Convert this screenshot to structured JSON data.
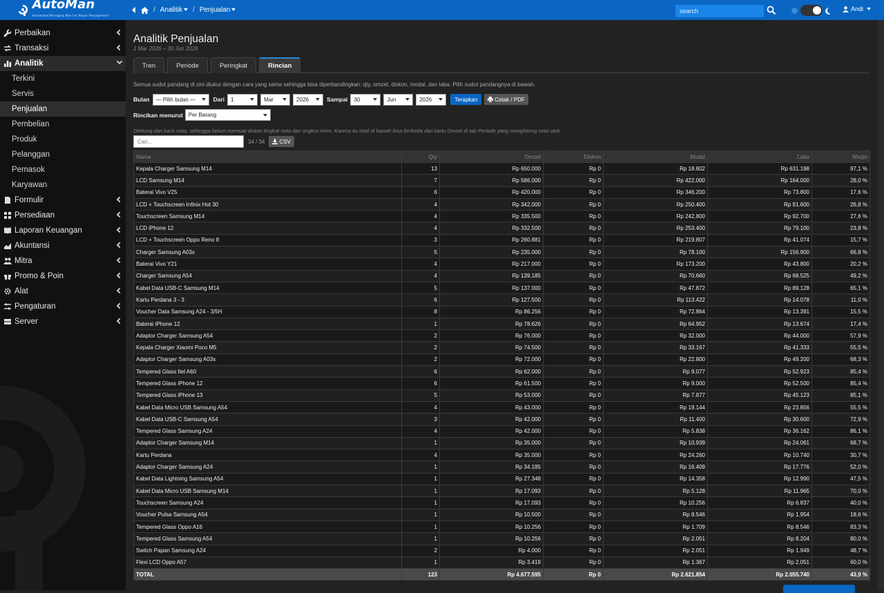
{
  "app": {
    "brand": "AutoMan",
    "brand_sub": "Automated Managing Man For Repair Management"
  },
  "breadcrumb": {
    "level1": "Analitik",
    "level2": "Penjualan"
  },
  "topbar": {
    "search_placeholder": "search",
    "user": "Andi"
  },
  "sidebar": {
    "items": [
      {
        "label": "Perbaikan",
        "icon": "wrench-icon"
      },
      {
        "label": "Transaksi",
        "icon": "exchange-icon"
      },
      {
        "label": "Analitik",
        "icon": "chart-icon"
      },
      {
        "label": "Formulir",
        "icon": "file-icon"
      },
      {
        "label": "Persediaan",
        "icon": "grid-icon"
      },
      {
        "label": "Laporan Keuangan",
        "icon": "book-icon"
      },
      {
        "label": "Akuntansi",
        "icon": "area-chart-icon"
      },
      {
        "label": "Mitra",
        "icon": "users-icon"
      },
      {
        "label": "Promo & Poin",
        "icon": "gift-icon"
      },
      {
        "label": "Alat",
        "icon": "cogs-icon"
      },
      {
        "label": "Pengaturan",
        "icon": "sliders-icon"
      },
      {
        "label": "Server",
        "icon": "server-icon"
      }
    ],
    "analitik_sub": [
      "Terkini",
      "Servis",
      "Penjualan",
      "Pembelian",
      "Produk",
      "Pelanggan",
      "Pemasok",
      "Karyawan"
    ]
  },
  "page": {
    "title": "Analitik Penjualan",
    "subtitle": "1 Mar 2026 – 30 Jun 2026",
    "tabs": [
      "Tren",
      "Periode",
      "Peringkat",
      "Rincian"
    ],
    "description": "Semua sudut pandang di sini diukur dengan cara yang sama sehingga bisa diperbandingkan: qty, omzet, diskon, modal, dan laba. Pilih sudut pandangnya di bawah.",
    "filters": {
      "bulan_label": "Bulan",
      "bulan_value": "— Pilih bulan —",
      "dari_label": "Dari",
      "dari_day": "1",
      "dari_month": "Mar",
      "dari_year": "2026",
      "sampai_label": "Sampai",
      "sampai_day": "30",
      "sampai_month": "Jun",
      "sampai_year": "2026",
      "apply": "Terapkan",
      "print": "Cetak / PDF"
    },
    "group_label": "Rincikan menurut",
    "group_value": "Per Barang",
    "note": "Dihitung dari baris nota, sehingga belum memuat diskon tingkat nota dan ongkos kirim. Karena itu total di bawah bisa berbeda dari kartu Omzet di tab Periode yang menghitung nota utuh.",
    "table_search_placeholder": "Cari...",
    "count": "34 / 34",
    "csv": "CSV"
  },
  "table": {
    "headers": [
      "Nama",
      "Qty",
      "Omzet",
      "Diskon",
      "Modal",
      "Laba",
      "Marjin"
    ],
    "rows": [
      [
        "Kepala Charger Samsung M14",
        "13",
        "Rp 650.000",
        "Rp 0",
        "Rp 18.802",
        "Rp 631.198",
        "97,1 %"
      ],
      [
        "LCD Samsung M14",
        "7",
        "Rp 586.000",
        "Rp 0",
        "Rp 422.000",
        "Rp 164.000",
        "28,0 %"
      ],
      [
        "Baterai Vivo V25",
        "6",
        "Rp 420.000",
        "Rp 0",
        "Rp 346.200",
        "Rp 73.800",
        "17,6 %"
      ],
      [
        "LCD + Touchscreen Infinix Hot 30",
        "4",
        "Rp 342.000",
        "Rp 0",
        "Rp 250.400",
        "Rp 91.600",
        "26,8 %"
      ],
      [
        "Touchscreen Samsung M14",
        "4",
        "Rp 335.500",
        "Rp 0",
        "Rp 242.800",
        "Rp 92.700",
        "27,6 %"
      ],
      [
        "LCD iPhone 12",
        "4",
        "Rp 332.500",
        "Rp 0",
        "Rp 253.400",
        "Rp 79.100",
        "23,8 %"
      ],
      [
        "LCD + Touchscreen Oppo Reno 8",
        "3",
        "Rp 260.881",
        "Rp 0",
        "Rp 219.807",
        "Rp 41.074",
        "15,7 %"
      ],
      [
        "Charger Samsung A03s",
        "5",
        "Rp 235.000",
        "Rp 0",
        "Rp 78.100",
        "Rp 156.900",
        "66,8 %"
      ],
      [
        "Baterai Vivo Y21",
        "4",
        "Rp 217.000",
        "Rp 0",
        "Rp 173.200",
        "Rp 43.800",
        "20,2 %"
      ],
      [
        "Charger Samsung A54",
        "4",
        "Rp 139.185",
        "Rp 0",
        "Rp 70.660",
        "Rp 68.525",
        "49,2 %"
      ],
      [
        "Kabel Data USB-C Samsung M14",
        "5",
        "Rp 137.000",
        "Rp 0",
        "Rp 47.872",
        "Rp 89.128",
        "65,1 %"
      ],
      [
        "Kartu Perdana 3 - 3",
        "6",
        "Rp 127.500",
        "Rp 0",
        "Rp 113.422",
        "Rp 14.078",
        "11,0 %"
      ],
      [
        "Voucher Data Samsung A24 - 3/5H",
        "8",
        "Rp 86.256",
        "Rp 0",
        "Rp 72.864",
        "Rp 13.391",
        "15,5 %"
      ],
      [
        "Baterai iPhone 12",
        "1",
        "Rp 78.626",
        "Rp 0",
        "Rp 64.952",
        "Rp 13.674",
        "17,4 %"
      ],
      [
        "Adaptor Charger Samsung A54",
        "2",
        "Rp 76.000",
        "Rp 0",
        "Rp 32.000",
        "Rp 44.000",
        "57,9 %"
      ],
      [
        "Kepala Charger Xiaomi Poco M5",
        "2",
        "Rp 74.500",
        "Rp 0",
        "Rp 33.167",
        "Rp 41.333",
        "55,5 %"
      ],
      [
        "Adaptor Charger Samsung A03s",
        "2",
        "Rp 72.000",
        "Rp 0",
        "Rp 22.800",
        "Rp 49.200",
        "68,3 %"
      ],
      [
        "Tempered Glass Itel A60",
        "6",
        "Rp 62.000",
        "Rp 0",
        "Rp 9.077",
        "Rp 52.923",
        "85,4 %"
      ],
      [
        "Tempered Glass iPhone 12",
        "6",
        "Rp 61.500",
        "Rp 0",
        "Rp 9.000",
        "Rp 52.500",
        "85,4 %"
      ],
      [
        "Tempered Glass iPhone 13",
        "5",
        "Rp 53.000",
        "Rp 0",
        "Rp 7.877",
        "Rp 45.123",
        "85,1 %"
      ],
      [
        "Kabel Data Micro USB Samsung A54",
        "4",
        "Rp 43.000",
        "Rp 0",
        "Rp 19.144",
        "Rp 23.856",
        "55,5 %"
      ],
      [
        "Kabel Data USB-C Samsung A54",
        "3",
        "Rp 42.000",
        "Rp 0",
        "Rp 11.400",
        "Rp 30.600",
        "72,9 %"
      ],
      [
        "Tempered Glass Samsung A24",
        "4",
        "Rp 42.000",
        "Rp 0",
        "Rp 5.838",
        "Rp 36.162",
        "86,1 %"
      ],
      [
        "Adaptor Charger Samsung M14",
        "1",
        "Rp 35.000",
        "Rp 0",
        "Rp 10.939",
        "Rp 24.061",
        "68,7 %"
      ],
      [
        "Kartu Perdana",
        "4",
        "Rp 35.000",
        "Rp 0",
        "Rp 24.260",
        "Rp 10.740",
        "30,7 %"
      ],
      [
        "Adaptor Charger Samsung A24",
        "1",
        "Rp 34.185",
        "Rp 0",
        "Rp 16.409",
        "Rp 17.776",
        "52,0 %"
      ],
      [
        "Kabel Data Lightning Samsung A54",
        "1",
        "Rp 27.348",
        "Rp 0",
        "Rp 14.358",
        "Rp 12.990",
        "47,5 %"
      ],
      [
        "Kabel Data Micro USB Samsung M14",
        "1",
        "Rp 17.093",
        "Rp 0",
        "Rp 5.128",
        "Rp 11.965",
        "70,0 %"
      ],
      [
        "Touchscreen Samsung A24",
        "1",
        "Rp 17.093",
        "Rp 0",
        "Rp 10.256",
        "Rp 6.837",
        "40,0 %"
      ],
      [
        "Voucher Pulsa Samsung A54",
        "1",
        "Rp 10.500",
        "Rp 0",
        "Rp 8.546",
        "Rp 1.954",
        "18,6 %"
      ],
      [
        "Tempered Glass Oppo A16",
        "1",
        "Rp 10.256",
        "Rp 0",
        "Rp 1.709",
        "Rp 8.546",
        "83,3 %"
      ],
      [
        "Tempered Glass Samsung A54",
        "1",
        "Rp 10.256",
        "Rp 0",
        "Rp 2.051",
        "Rp 8.204",
        "80,0 %"
      ],
      [
        "Switch Papan Samsung A24",
        "2",
        "Rp 4.000",
        "Rp 0",
        "Rp 2.051",
        "Rp 1.949",
        "48,7 %"
      ],
      [
        "Flexi LCD Oppo A57",
        "1",
        "Rp 3.419",
        "Rp 0",
        "Rp 1.367",
        "Rp 2.051",
        "60,0 %"
      ]
    ],
    "total": [
      "TOTAL",
      "123",
      "Rp 4.677.595",
      "Rp 0",
      "Rp 2.621.854",
      "Rp 2.055.740",
      "43,9 %"
    ]
  },
  "colors": {
    "accent": "#0a66c2",
    "sidebar_bg": "#111111",
    "main_bg": "#222222"
  }
}
